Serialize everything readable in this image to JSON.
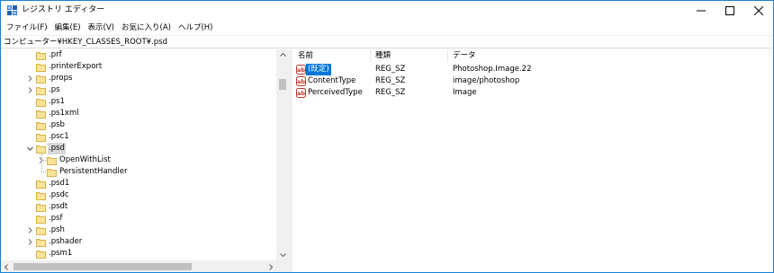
{
  "window": {
    "title": "レジストリ エディター",
    "controls": {
      "minimize": "minimize",
      "maximize": "maximize",
      "close": "close"
    }
  },
  "menu": [
    "ファイル(F)",
    "編集(E)",
    "表示(V)",
    "お気に入り(A)",
    "ヘルプ(H)"
  ],
  "address": {
    "path": "コンピューター¥HKEY_CLASSES_ROOT¥.psd"
  },
  "tree": {
    "items": [
      {
        "label": ".prf",
        "depth": 0,
        "expander": "none"
      },
      {
        "label": ".printerExport",
        "depth": 0,
        "expander": "none"
      },
      {
        "label": ".props",
        "depth": 0,
        "expander": "collapsed"
      },
      {
        "label": ".ps",
        "depth": 0,
        "expander": "collapsed"
      },
      {
        "label": ".ps1",
        "depth": 0,
        "expander": "none"
      },
      {
        "label": ".ps1xml",
        "depth": 0,
        "expander": "none"
      },
      {
        "label": ".psb",
        "depth": 0,
        "expander": "none"
      },
      {
        "label": ".psc1",
        "depth": 0,
        "expander": "none"
      },
      {
        "label": ".psd",
        "depth": 0,
        "expander": "expanded",
        "selected": true
      },
      {
        "label": "OpenWithList",
        "depth": 1,
        "expander": "collapsed"
      },
      {
        "label": "PersistentHandler",
        "depth": 1,
        "expander": "none"
      },
      {
        "label": ".psd1",
        "depth": 0,
        "expander": "none"
      },
      {
        "label": ".psdc",
        "depth": 0,
        "expander": "none"
      },
      {
        "label": ".psdt",
        "depth": 0,
        "expander": "none"
      },
      {
        "label": ".psf",
        "depth": 0,
        "expander": "none"
      },
      {
        "label": ".psh",
        "depth": 0,
        "expander": "collapsed"
      },
      {
        "label": ".pshader",
        "depth": 0,
        "expander": "collapsed"
      },
      {
        "label": ".psm1",
        "depth": 0,
        "expander": "none"
      }
    ]
  },
  "list": {
    "headers": {
      "name": "名前",
      "type": "種類",
      "data": "データ"
    },
    "rows": [
      {
        "name": "(既定)",
        "type": "REG_SZ",
        "data": "Photoshop.Image.22",
        "selected": true
      },
      {
        "name": "ContentType",
        "type": "REG_SZ",
        "data": "image/photoshop"
      },
      {
        "name": "PerceivedType",
        "type": "REG_SZ",
        "data": "Image"
      }
    ]
  },
  "colors": {
    "selection": "#0078d7",
    "tree_selection": "#d9d9d9",
    "folder": "#f7d774",
    "border": "#1883d7"
  },
  "icons": {
    "app": "registry-editor-icon",
    "value": "string-value-ab-icon",
    "folder": "folder-icon"
  }
}
